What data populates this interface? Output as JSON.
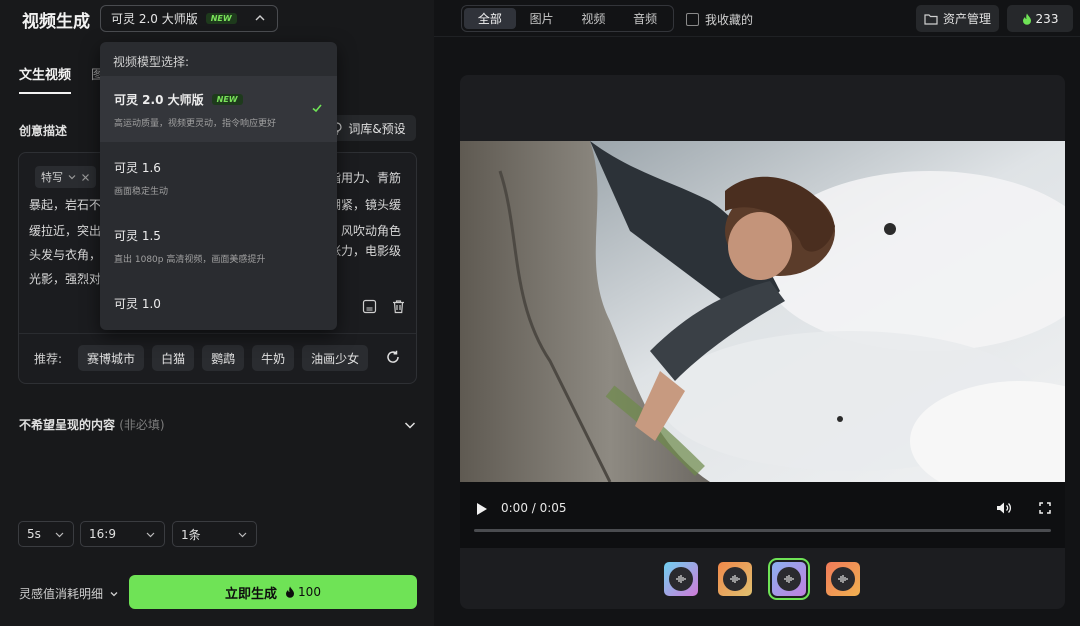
{
  "header": {
    "title": "视频生成",
    "model_selected": "可灵 2.0 大师版",
    "new_badge": "NEW"
  },
  "tabs": [
    {
      "label": "文生视频",
      "active": true
    },
    {
      "label": "图",
      "active": false
    }
  ],
  "prompt": {
    "section_label": "创意描述",
    "library_button": "词库&预设",
    "tag_chip": "特写",
    "lines_left": [
      "暴起，岩石不断",
      "缓拉近，突出生",
      "头发与衣角，发",
      "光影，强烈对比"
    ],
    "lines_right": [
      "指用力、青筋",
      "绷紧，镜头缓",
      "，风吹动角色",
      "张力，电影级"
    ],
    "recommend_label": "推荐:",
    "recommend_chips": [
      "赛博城市",
      "白猫",
      "鹦鹉",
      "牛奶",
      "油画少女"
    ]
  },
  "negative": {
    "label": "不希望呈现的内容",
    "optional": "(非必填)"
  },
  "params": {
    "duration": "5s",
    "ratio": "16:9",
    "count": "1条"
  },
  "footer": {
    "cost_detail": "灵感值消耗明细",
    "generate_label": "立即生成",
    "generate_cost": "100"
  },
  "dropdown": {
    "heading": "视频模型选择:",
    "items": [
      {
        "name": "可灵 2.0 大师版",
        "desc": "高运动质量，视频更灵动，指令响应更好",
        "badge": "NEW",
        "selected": true
      },
      {
        "name": "可灵 1.6",
        "desc": "画面稳定生动",
        "selected": false
      },
      {
        "name": "可灵 1.5",
        "desc": "直出 1080p 高清视频，画面美感提升",
        "selected": false
      },
      {
        "name": "可灵 1.0",
        "desc": "",
        "selected": false
      }
    ]
  },
  "toolbar": {
    "filters": [
      "全部",
      "图片",
      "视频",
      "音频"
    ],
    "active_filter": "全部",
    "favorites_label": "我收藏的",
    "asset_label": "资产管理",
    "credits": "233"
  },
  "player": {
    "time": "0:00 / 0:05",
    "progress": 0.0
  },
  "thumbnails": [
    {
      "colors": [
        "#6fd0f0",
        "#d07ad8"
      ],
      "selected": false
    },
    {
      "colors": [
        "#f0884a",
        "#e0c070"
      ],
      "selected": false
    },
    {
      "colors": [
        "#8ab0f0",
        "#c080e0"
      ],
      "selected": true
    },
    {
      "colors": [
        "#f07a5a",
        "#f0b050"
      ],
      "selected": false
    }
  ],
  "colors": {
    "accent": "#6fe356",
    "panel": "#18191b",
    "background": "#121315"
  }
}
